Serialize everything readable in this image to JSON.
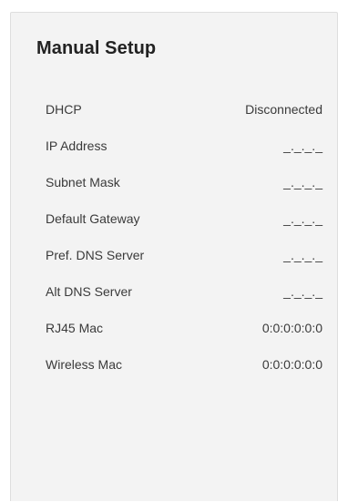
{
  "panel": {
    "title": "Manual Setup",
    "rows": [
      {
        "label": "DHCP",
        "value": "Disconnected"
      },
      {
        "label": "IP Address",
        "value": "_._._._"
      },
      {
        "label": "Subnet Mask",
        "value": "_._._._"
      },
      {
        "label": "Default Gateway",
        "value": "_._._._"
      },
      {
        "label": "Pref. DNS Server",
        "value": "_._._._"
      },
      {
        "label": "Alt DNS Server",
        "value": "_._._._"
      },
      {
        "label": "RJ45 Mac",
        "value": "0:0:0:0:0:0"
      },
      {
        "label": "Wireless Mac",
        "value": "0:0:0:0:0:0"
      }
    ]
  }
}
